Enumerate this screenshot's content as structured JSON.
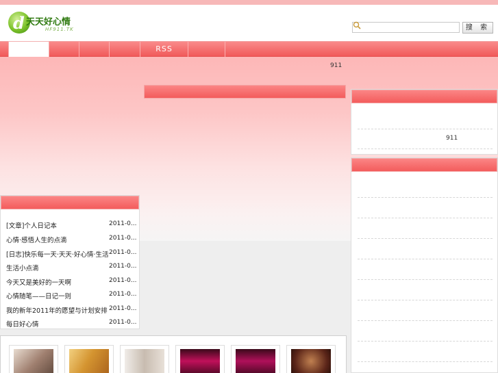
{
  "logo": {
    "mark": "d",
    "text": "天天好心情",
    "sub": "HF911.TK"
  },
  "search": {
    "placeholder": "",
    "button_label": "搜 索"
  },
  "nav": {
    "items": [
      {
        "label": ""
      },
      {
        "label": ""
      },
      {
        "label": ""
      },
      {
        "label": ""
      },
      {
        "label": "RSS"
      },
      {
        "label": ""
      }
    ]
  },
  "visit_counts": {
    "top": "911",
    "sidebar": "911"
  },
  "article_list": [
    {
      "title": "[文章]个人日记本",
      "date": "2011-0..."
    },
    {
      "title": "心情·感悟人生的点滴",
      "date": "2011-0..."
    },
    {
      "title": "[日志]快乐每一天·天天·好心情·生活记录·分享美好时光",
      "date": "2011-0..."
    },
    {
      "title": "生活小点滴",
      "date": "2011-0..."
    },
    {
      "title": "今天又是美好的一天啊",
      "date": "2011-0..."
    },
    {
      "title": "心情随笔——日记一则",
      "date": "2011-0..."
    },
    {
      "title": "我的新年2011年的愿望与计划安排",
      "date": "2011-0..."
    },
    {
      "title": "每日好心情",
      "date": "2011-0..."
    }
  ],
  "gallery": [
    {
      "icon": "photo-thumbnail-1",
      "color": "#b8a090"
    },
    {
      "icon": "photo-thumbnail-2",
      "color": "#d4a040"
    },
    {
      "icon": "photo-thumbnail-3",
      "color": "#d8d0c8"
    },
    {
      "icon": "photo-thumbnail-4",
      "color": "#c0105a"
    },
    {
      "icon": "photo-thumbnail-5",
      "color": "#b0105a"
    },
    {
      "icon": "photo-thumbnail-6",
      "color": "#5a2418"
    }
  ],
  "colors": {
    "accent": "#f15a5a",
    "accent_light": "#fb8585",
    "logo_green": "#2f7a10"
  }
}
